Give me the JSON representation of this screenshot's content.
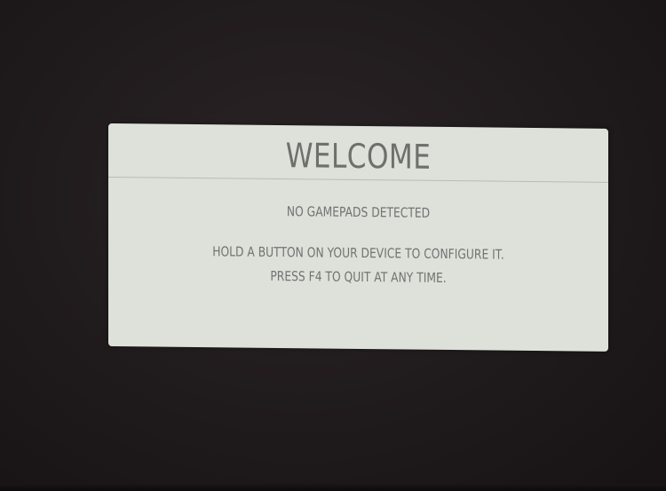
{
  "dialog": {
    "title": "WELCOME",
    "status": "NO GAMEPADS DETECTED",
    "instruction_line1": "HOLD A BUTTON ON YOUR DEVICE TO CONFIGURE IT.",
    "instruction_line2": "PRESS F4 TO QUIT AT ANY TIME."
  },
  "colors": {
    "background": "#1f1a1c",
    "dialog_bg": "#dde1da",
    "text": "#6e706c"
  }
}
